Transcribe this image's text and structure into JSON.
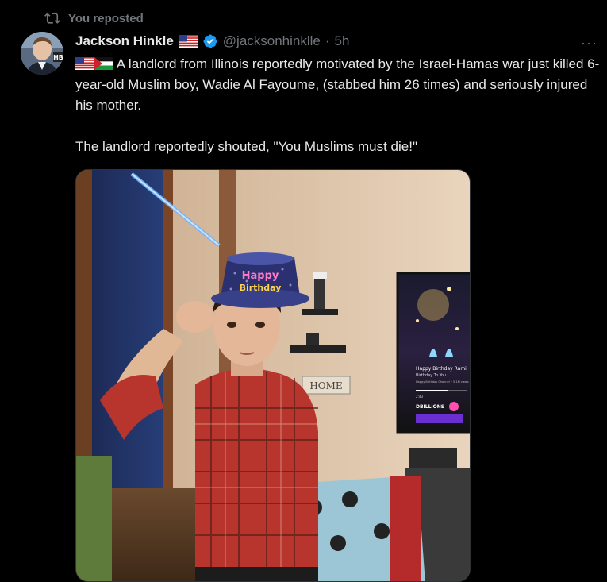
{
  "repost": {
    "label": "You reposted",
    "icon": "repost-icon"
  },
  "author": {
    "name": "Jackson Hinkle",
    "name_flag_icon": "us-flag-icon",
    "verified_icon": "verified-badge-icon",
    "handle": "@jacksonhinklle",
    "separator": "·",
    "time": "5h",
    "avatar_initials": "HB"
  },
  "more_label": "···",
  "tweet": {
    "line1_text": "A landlord from Illinois reportedly motivated by the Israel-Hamas war just killed 6-year-old Muslim boy, Wadie Al Fayoume, (stabbed him 26 times) and seriously injured his mother.",
    "line1_flags": [
      "us-flag-icon",
      "palestine-flag-icon"
    ],
    "line2_text": "The landlord reportedly shouted, \"You Muslims must die!\""
  },
  "media": {
    "hat_text_line1": "Happy",
    "hat_text_line2": "Birthday",
    "wall_sign": "HOME",
    "tv_title": "Happy Birthday Rami",
    "tv_subtitle": "Birthday To You",
    "tv_channel": "Happy Birthday Channel • 5.1M views",
    "tv_time": "2:43",
    "tv_banner": "DBILLIONS",
    "colors": {
      "background": "#000000",
      "text": "#e7e9ea",
      "muted": "#71767b",
      "verified": "#1d9bf0"
    }
  }
}
